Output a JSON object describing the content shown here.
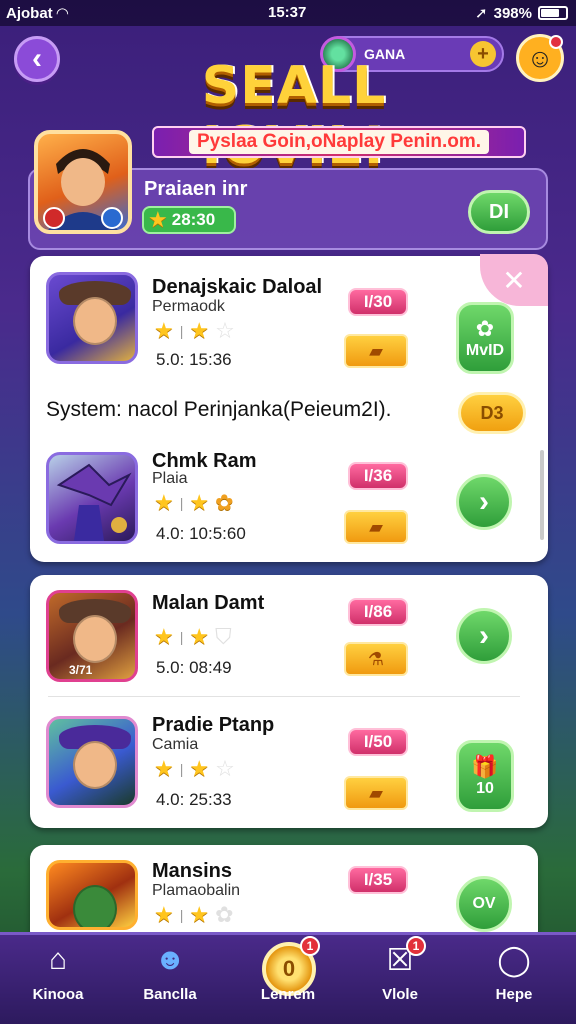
{
  "status_bar": {
    "carrier": "Ajobat",
    "time": "15:37",
    "battery": "398%"
  },
  "header": {
    "currency_label": "GANA",
    "title": "SEALL IOVIL!",
    "banner": "Pyslaa Goin,oNaplay Penin.om."
  },
  "player": {
    "name": "Praiaen inr",
    "score": "28:30",
    "button_label": "DI"
  },
  "list": [
    {
      "title": "Denajskaic Daloal",
      "subtitle": "Permaodk",
      "stars": 2,
      "time": "5.0: 15:36",
      "tag": "I/30",
      "action": "MvID"
    },
    {
      "title": "Chmk Ram",
      "subtitle": "Plaia",
      "stars": 2,
      "time": "4.0: 10:5:60",
      "tag": "I/36",
      "action": "›"
    },
    {
      "title": "Malan Damt",
      "subtitle": "",
      "stars": 2,
      "time": "5.0: 08:49",
      "tag": "I/86",
      "action": "›"
    },
    {
      "title": "Pradie Ptanp",
      "subtitle": "Camia",
      "stars": 2,
      "time": "4.0: 25:33",
      "tag": "I/50",
      "action": "10"
    },
    {
      "title": "Mansins",
      "subtitle": "Plamaobalin",
      "stars": 2,
      "tag": "I/35",
      "action": "OV"
    }
  ],
  "system": {
    "text": "System: nacol Perinjanka(Peieum2I).",
    "button": "D3"
  },
  "bottom_nav": [
    {
      "label": "Kinooa"
    },
    {
      "label": "Banclla"
    },
    {
      "label": "Lenrem"
    },
    {
      "label": "Vlole"
    },
    {
      "label": "Hepe"
    }
  ],
  "badges": {
    "center": "1",
    "vlole": "1"
  },
  "thumb_label_row3": "3/71"
}
